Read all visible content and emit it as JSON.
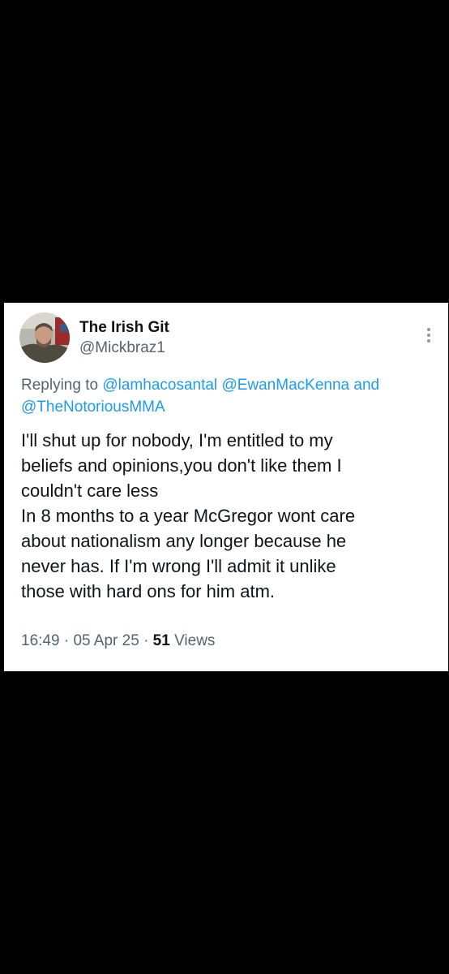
{
  "tweet": {
    "display_name": "The Irish Git",
    "handle": "@Mickbraz1",
    "replying_prefix": "Replying to ",
    "mentions": [
      "@lamhacosantal",
      "@EwanMacKenna",
      "@TheNotoriousMMA"
    ],
    "mention_joiner": " and",
    "text_lines": [
      "I'll shut up for nobody, I'm entitled to my",
      "beliefs and opinions,you don't like them I",
      "couldn't care less",
      "In 8 months to a year McGregor wont care",
      "about nationalism any longer because he",
      "never has. If I'm wrong I'll admit it unlike",
      "those with hard ons for him atm."
    ],
    "time": "16:49",
    "date": "05 Apr 25",
    "separator": "·",
    "views_count": "51",
    "views_label": "Views"
  },
  "icons": {
    "avatar": "profile-photo",
    "more": "more-vertical-icon"
  },
  "colors": {
    "background": "#000000",
    "card": "#ffffff",
    "primary_text": "#0f1419",
    "secondary_text": "#536471",
    "link": "#1d9bf0"
  }
}
